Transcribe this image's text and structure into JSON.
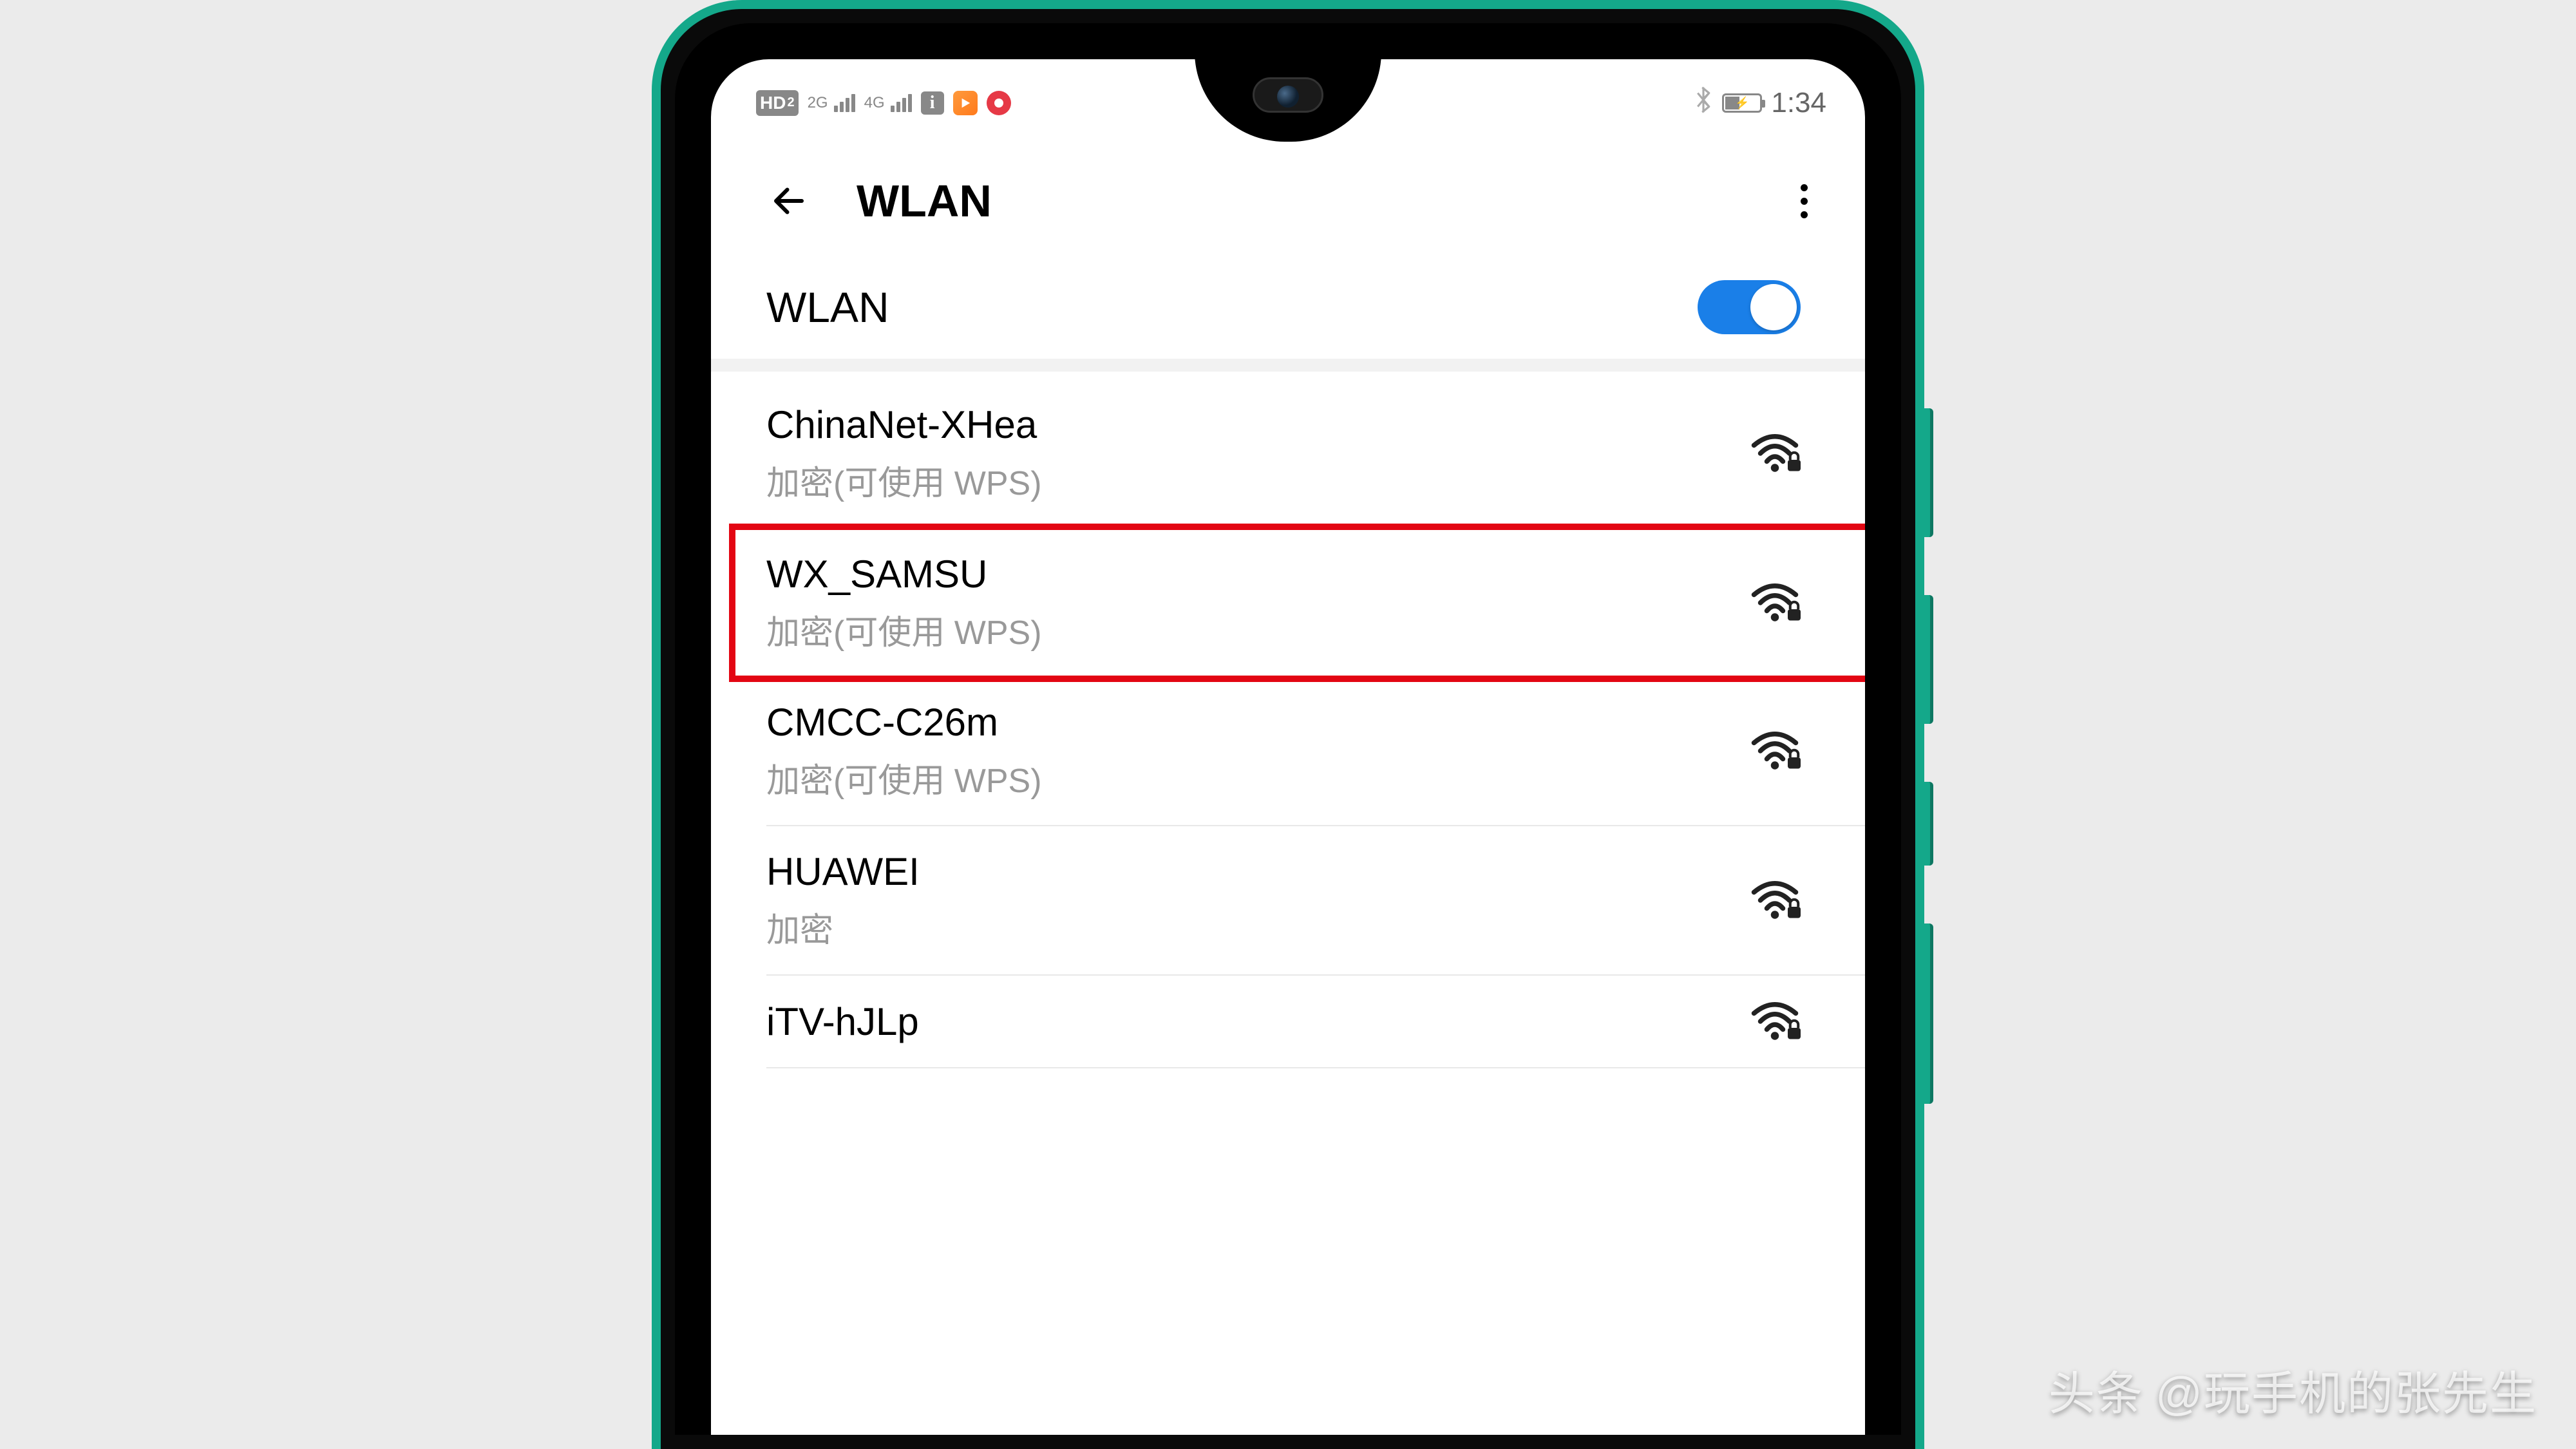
{
  "status_bar": {
    "hd_label": "HD",
    "hd_sub": "2",
    "sig1_label": "2G",
    "sig2_label": "4G",
    "time": "1:34"
  },
  "header": {
    "title": "WLAN"
  },
  "wlan_toggle": {
    "label": "WLAN",
    "enabled": true
  },
  "networks": [
    {
      "ssid": "ChinaNet-XHea",
      "security": "加密(可使用 WPS)",
      "highlighted": false
    },
    {
      "ssid": "WX_SAMSU",
      "security": "加密(可使用 WPS)",
      "highlighted": true
    },
    {
      "ssid": "CMCC-C26m",
      "security": "加密(可使用 WPS)",
      "highlighted": false
    },
    {
      "ssid": "HUAWEI",
      "security": "加密",
      "highlighted": false
    },
    {
      "ssid": "iTV-hJLp",
      "security": "",
      "highlighted": false
    }
  ],
  "watermark": {
    "brand": "头条",
    "handle": "@玩手机的张先生"
  },
  "colors": {
    "accent": "#1a7fe8",
    "frame": "#14a88a",
    "highlight": "#e30613"
  }
}
